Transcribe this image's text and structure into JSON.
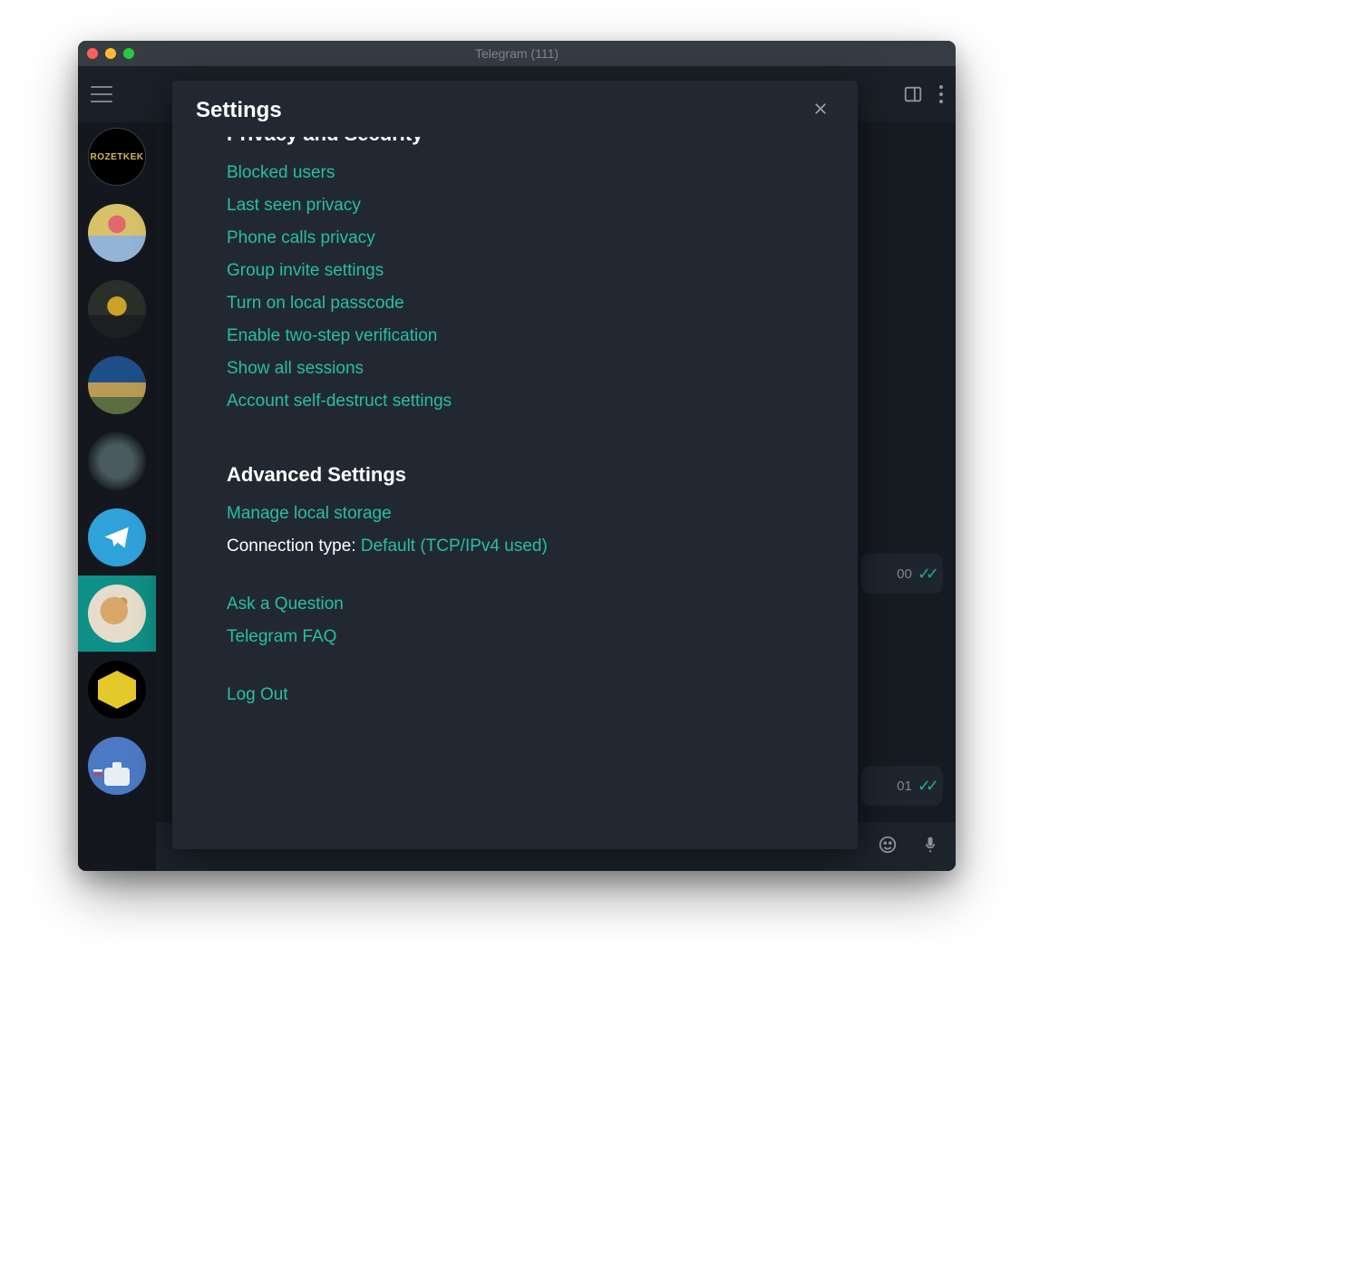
{
  "window": {
    "title": "Telegram (111)"
  },
  "settings": {
    "title": "Settings",
    "privacy": {
      "heading": "Privacy and Security",
      "items": [
        "Blocked users",
        "Last seen privacy",
        "Phone calls privacy",
        "Group invite settings",
        "Turn on local passcode",
        "Enable two-step verification",
        "Show all sessions",
        "Account self-destruct settings"
      ]
    },
    "advanced": {
      "heading": "Advanced Settings",
      "storage": "Manage local storage",
      "conn_label": "Connection type:",
      "conn_value": "Default (TCP/IPv4 used)"
    },
    "help": {
      "ask": "Ask a Question",
      "faq": "Telegram FAQ"
    },
    "logout": "Log Out"
  },
  "chatlist": [
    {
      "id": "rozetkek",
      "label": "ROZETKEK"
    },
    {
      "id": "woman"
    },
    {
      "id": "hiker"
    },
    {
      "id": "beach"
    },
    {
      "id": "storm"
    },
    {
      "id": "telegram"
    },
    {
      "id": "guy",
      "selected": true
    },
    {
      "id": "hex"
    },
    {
      "id": "cam"
    }
  ],
  "bubbles": {
    "a": "00",
    "b": "01"
  }
}
